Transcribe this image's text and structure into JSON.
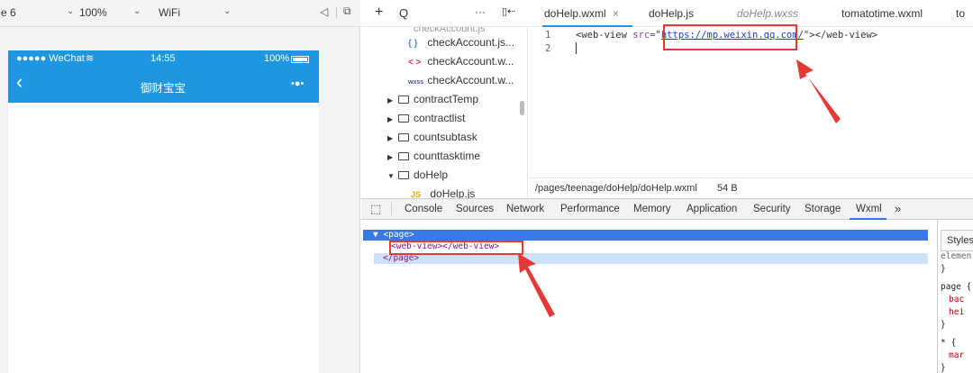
{
  "simulator": {
    "device": "e 6",
    "zoom": "100%",
    "network": "WiFi",
    "statusbar": {
      "carrier": "●●●●● WeChat",
      "time": "14:55",
      "battery": "100%"
    },
    "navbar": {
      "back": "‹",
      "title": "御财宝宝",
      "menu": "•●•"
    }
  },
  "filetree": {
    "toolbar": {
      "add": "+",
      "search": "Q",
      "more": "···",
      "collapse": "▯⇠"
    },
    "items": [
      {
        "icon": "{ }",
        "label": "checkAccount.js...",
        "icon_color": "#4a90e2"
      },
      {
        "icon": "< >",
        "label": "checkAccount.w...",
        "icon_color": "#e53935"
      },
      {
        "icon": "wxss",
        "label": "checkAccount.w...",
        "icon_color": "#3f51b5"
      },
      {
        "label": "contractTemp"
      },
      {
        "label": "contractlist"
      },
      {
        "label": "countsubtask"
      },
      {
        "label": "counttasktime"
      },
      {
        "label": "doHelp"
      },
      {
        "icon": "JS",
        "label": "doHelp.js",
        "icon_color": "#f0a30a"
      }
    ]
  },
  "editor": {
    "tabs": [
      {
        "label": "doHelp.wxml",
        "close": "×"
      },
      {
        "label": "doHelp.js"
      },
      {
        "label": "doHelp.wxss"
      },
      {
        "label": "tomatotime.wxml"
      },
      {
        "label": "to"
      }
    ],
    "line_numbers": [
      "1",
      "2"
    ],
    "code": {
      "open_tag": "<web-view",
      "attr": "src=",
      "quote_open": "\"",
      "url": "https://mp.weixin.qq.com/",
      "quote_close": "\"",
      "rest": "></web-view>"
    },
    "status": {
      "path": "/pages/teenage/doHelp/doHelp.wxml",
      "size": "54 B"
    }
  },
  "devtools": {
    "inspect": "⬚",
    "tabs": [
      "Console",
      "Sources",
      "Network",
      "Performance",
      "Memory",
      "Application",
      "Security",
      "Storage",
      "Wxml",
      "»"
    ],
    "dom": {
      "page_open": "▼ <page>",
      "webview": "<web-view></web-view>",
      "page_close": "</page>"
    },
    "styles": {
      "tab": "Styles",
      "lines": [
        "elemen",
        "}",
        "page {",
        "bac",
        "hei",
        "}",
        "* {",
        "mar",
        "}"
      ]
    }
  },
  "colors": {
    "wechat_blue": "#1e96e0",
    "highlight_red": "#e53935",
    "dom_select": "#3b78e7"
  }
}
